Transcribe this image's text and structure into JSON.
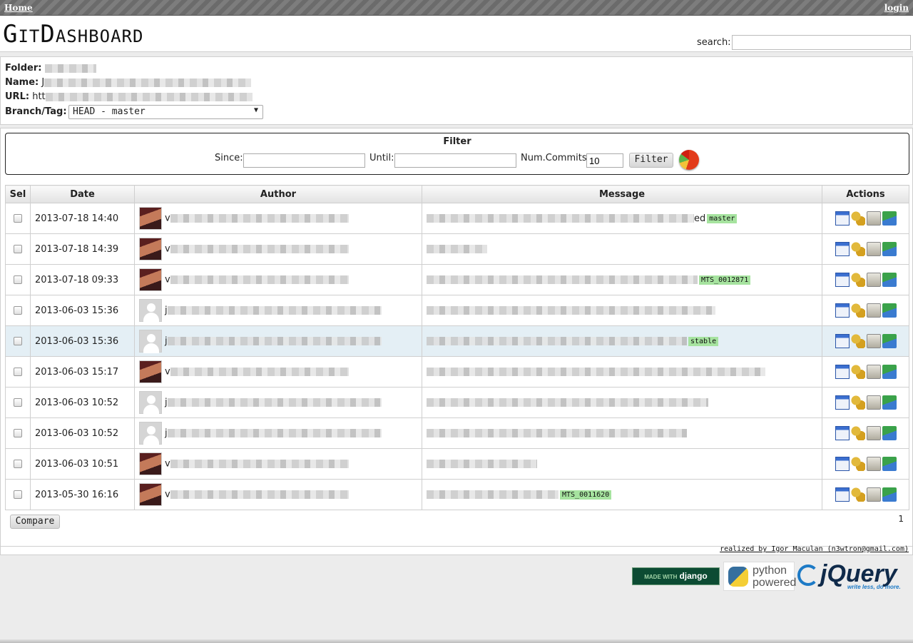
{
  "nav": {
    "home": "Home",
    "login": "login"
  },
  "header": {
    "logo": "GitDashboard",
    "search_label": "search:",
    "search_value": ""
  },
  "repo": {
    "folder_label": "Folder:",
    "name_label": "Name:",
    "url_label": "URL:",
    "branch_label": "Branch/Tag:",
    "folder_value_visible": "",
    "name_value_visible": "J",
    "url_value_visible": "htt",
    "branch_value": "HEAD - master"
  },
  "filter": {
    "title": "Filter",
    "since_label": "Since:",
    "until_label": "Until:",
    "num_commits_label": "Num.Commits:",
    "num_commits_value": "10",
    "button": "Filter"
  },
  "table": {
    "headers": [
      "Sel",
      "Date",
      "Author",
      "Message",
      "Actions"
    ],
    "rows": [
      {
        "date": "2013-07-18 14:40",
        "avatar": "photo",
        "author_initial": "v",
        "message_tail": "ed",
        "tag": "master"
      },
      {
        "date": "2013-07-18 14:39",
        "avatar": "photo",
        "author_initial": "v",
        "message_tail": "",
        "tag": ""
      },
      {
        "date": "2013-07-18 09:33",
        "avatar": "photo",
        "author_initial": "v",
        "message_tail": "",
        "tag": "MTS_0012871"
      },
      {
        "date": "2013-06-03 15:36",
        "avatar": "default",
        "author_initial": "j",
        "message_tail": "",
        "tag": ""
      },
      {
        "date": "2013-06-03 15:36",
        "avatar": "default",
        "author_initial": "j",
        "message_tail": "",
        "tag": "stable"
      },
      {
        "date": "2013-06-03 15:17",
        "avatar": "photo",
        "author_initial": "v",
        "message_tail": "",
        "tag": ""
      },
      {
        "date": "2013-06-03 10:52",
        "avatar": "default",
        "author_initial": "j",
        "message_tail": "",
        "tag": ""
      },
      {
        "date": "2013-06-03 10:52",
        "avatar": "default",
        "author_initial": "j",
        "message_tail": "",
        "tag": ""
      },
      {
        "date": "2013-06-03 10:51",
        "avatar": "photo",
        "author_initial": "v",
        "message_tail": "",
        "tag": ""
      },
      {
        "date": "2013-05-30 16:16",
        "avatar": "photo",
        "author_initial": "v",
        "message_tail": "",
        "tag": "MTS_0011620"
      }
    ],
    "action_icons": [
      "commit-details-icon",
      "tree-icon",
      "archive-icon",
      "graph-icon"
    ],
    "highlighted_row": 5
  },
  "compare_button": "Compare",
  "page_number": "1",
  "credits": "realized by Igor Maculan (n3wtron@gmail.com)",
  "badges": {
    "django_small": "MADE WITH",
    "django": "django",
    "python_line1": "python",
    "python_line2": "powered",
    "jquery": "jQuery",
    "jquery_tagline": "write less, do more."
  },
  "colors": {
    "tag_bg": "#a6e39f",
    "highlight_row": "#e4eff5",
    "topbar": "#6b6b6b"
  }
}
